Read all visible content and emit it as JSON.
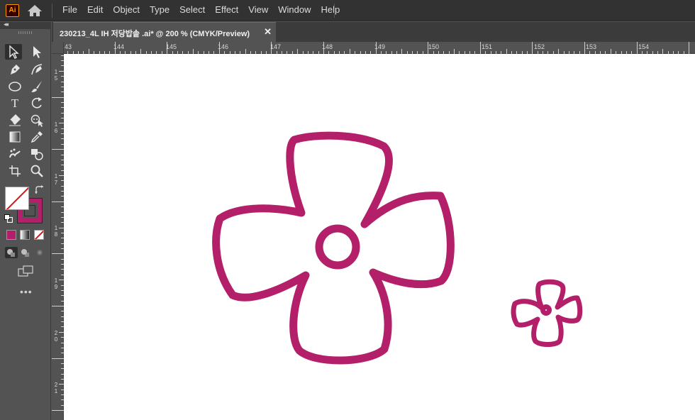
{
  "app": {
    "logo": "Ai",
    "home_icon": "home-icon"
  },
  "menu": [
    "File",
    "Edit",
    "Object",
    "Type",
    "Select",
    "Effect",
    "View",
    "Window",
    "Help"
  ],
  "toolbar": {
    "collapse_glyph": "◂◂",
    "tools": [
      "selection-tool-icon",
      "direct-selection-tool-icon",
      "pen-tool-icon",
      "curvature-tool-icon",
      "ellipse-tool-icon",
      "paintbrush-tool-icon",
      "type-tool-icon",
      "rotate-tool-icon",
      "eraser-tool-icon",
      "puppet-warp-tool-icon",
      "gradient-tool-icon",
      "eyedropper-tool-icon",
      "symbol-sprayer-tool-icon",
      "shape-builder-tool-icon",
      "artboard-tool-icon",
      "zoom-tool-icon"
    ],
    "fill": "none",
    "stroke_color": "#b41f6a",
    "more_label": "•••"
  },
  "document": {
    "tab_title": "230213_4L  IH 저당밥솥 .ai* @ 200 % (CMYK/Preview)",
    "close_glyph": "✕"
  },
  "rulers": {
    "horizontal": [
      "43",
      "144",
      "145",
      "146",
      "147",
      "148",
      "149",
      "150",
      "151",
      "152",
      "153",
      "154"
    ],
    "vertical": [
      [
        "1",
        "5"
      ],
      [
        "1",
        "6"
      ],
      [
        "1",
        "7"
      ],
      [
        "1",
        "8"
      ],
      [
        "1",
        "9"
      ],
      [
        "2",
        "0"
      ],
      [
        "2",
        "1"
      ]
    ]
  },
  "artwork": {
    "stroke_color": "#b41f6a",
    "shapes": [
      "flower-large",
      "flower-small"
    ]
  }
}
